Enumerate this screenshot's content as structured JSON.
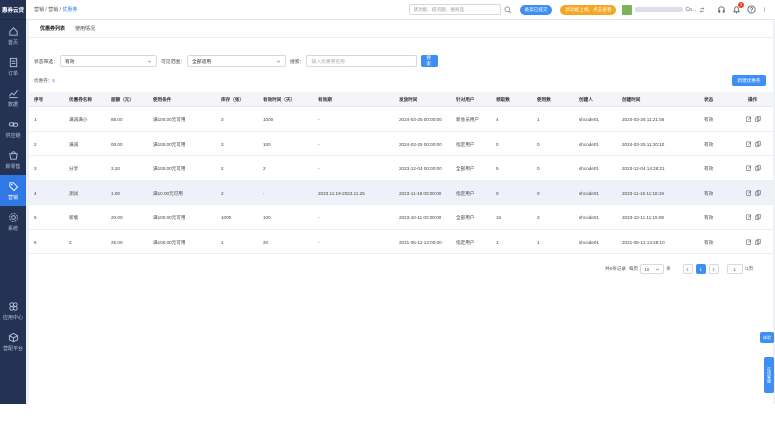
{
  "brand": "惠券云贷",
  "sidebar": {
    "items": [
      {
        "label": "首页",
        "icon": "home-icon"
      },
      {
        "label": "订单",
        "icon": "order-icon"
      },
      {
        "label": "数据",
        "icon": "chart-icon"
      },
      {
        "label": "供应链",
        "icon": "link-icon"
      },
      {
        "label": "新零售",
        "icon": "retail-icon"
      },
      {
        "label": "营销",
        "icon": "tag-icon",
        "active": true
      },
      {
        "label": "系统",
        "icon": "gear-icon"
      }
    ],
    "lower_items": [
      {
        "label": "应用中心",
        "icon": "apps-icon"
      },
      {
        "label": "营配平台",
        "icon": "cube-icon"
      }
    ]
  },
  "topbar": {
    "breadcrumb": {
      "a": "营销",
      "sep": " / ",
      "b": "营销",
      "c": "优惠券"
    },
    "search_placeholder": "请功能、提问题、搜商品",
    "pill_blue": "备案已提交",
    "pill_orange": "新功能上线，点击查看",
    "user_suffix": "Co...",
    "notify_count": "3"
  },
  "tabs": [
    "优惠券列表",
    "使用情况"
  ],
  "filters": {
    "status_label": "状态筛选：",
    "status_value": "有效",
    "scope_label": "可见范围：",
    "scope_value": "全部适用",
    "search_label": "搜索：",
    "search_placeholder": "输入优惠券名称",
    "search_button": "搜索"
  },
  "summary": {
    "label": "优惠券：",
    "count": "6"
  },
  "add_button": "新建优惠券",
  "table": {
    "headers": [
      "序号",
      "优惠券名称",
      "面额（元）",
      "使用条件",
      "库存（张）",
      "有效时间（天）",
      "有效期",
      "发放时间",
      "针对用户",
      "领取数",
      "使用数",
      "创建人",
      "创建时间",
      "状态",
      "操作"
    ],
    "rows": [
      [
        "1",
        "满减满小",
        "88.00",
        "满100.00元可用",
        "3",
        "1000",
        "-",
        "2024-03-25 00:00:00",
        "新会员用户",
        "4",
        "1",
        "shcode01",
        "2024-03-25 11:21:56",
        "有效"
      ],
      [
        "2",
        "满减",
        "00.00",
        "满100.00元可用",
        "3",
        "100",
        "-",
        "2024-03-25 00:00:00",
        "指定用户",
        "0",
        "0",
        "shcode01",
        "2024-03-25 11:20:10",
        "有效"
      ],
      [
        "3",
        "分享",
        "3.20",
        "满100.00元可用",
        "2",
        "2",
        "-",
        "2023-12-04 00:00:00",
        "全部用户",
        "5",
        "0",
        "shcode01",
        "2023-12-04 14:26:21",
        "有效"
      ],
      [
        "4",
        "测试",
        "1.00",
        "满10.00元可用",
        "2",
        "-",
        "2023.11.19-2023.11.25",
        "2023-11-19 00:00:00",
        "指定用户",
        "0",
        "0",
        "shcode01",
        "2023-11-16 11:18:19",
        "有效"
      ],
      [
        "5",
        "新版",
        "20.00",
        "满100.00元可用",
        "1000",
        "100",
        "-",
        "2023-10-11 00:00:00",
        "全部用户",
        "16",
        "3",
        "shcode01",
        "2023-10-11 11:15:08",
        "有效"
      ],
      [
        "6",
        "2",
        "25.00",
        "满100.00元可用",
        "1",
        "20",
        "-",
        "2021-05-12 12:00:00",
        "指定用户",
        "1",
        "1",
        "shcode01",
        "2021-05-12 13:48:10",
        "有效"
      ]
    ]
  },
  "pager": {
    "total": "共6条记录",
    "per_page_label": "每页",
    "per_page_value": "10",
    "unit": "条",
    "current": "1",
    "jump_value": "1",
    "page_total": "/1页"
  },
  "float_a": "体验",
  "float_b": "在线客服",
  "colors": {
    "sidebar": "#243353",
    "accent": "#3d8ef5",
    "orange": "#f5a623"
  }
}
